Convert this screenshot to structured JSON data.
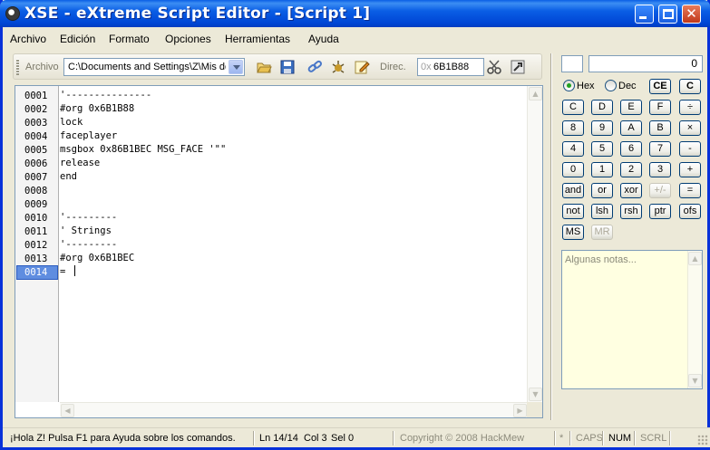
{
  "window": {
    "title": "XSE - eXtreme Script Editor - [Script 1]"
  },
  "menu": [
    "Archivo",
    "Edición",
    "Formato",
    "Opciones",
    "Herramientas",
    "Ayuda"
  ],
  "toolbar": {
    "file_label": "Archivo",
    "path_value": "C:\\Documents and Settings\\Z\\Mis documentos",
    "addr_label": "Direc.",
    "addr_prefix": "0x",
    "addr_value": "6B1B88",
    "icons": [
      "open-icon",
      "save-icon",
      "link-icon",
      "compile-icon",
      "edit-icon",
      "cut-icon",
      "tool-icon"
    ]
  },
  "editor": {
    "active_line": 14,
    "lines": [
      {
        "num": "0001",
        "text": "'---------------"
      },
      {
        "num": "0002",
        "text": "#org 0x6B1B88"
      },
      {
        "num": "0003",
        "text": "lock"
      },
      {
        "num": "0004",
        "text": "faceplayer"
      },
      {
        "num": "0005",
        "text": "msgbox 0x86B1BEC MSG_FACE '\"\""
      },
      {
        "num": "0006",
        "text": "release"
      },
      {
        "num": "0007",
        "text": "end"
      },
      {
        "num": "0008",
        "text": ""
      },
      {
        "num": "0009",
        "text": ""
      },
      {
        "num": "0010",
        "text": "'---------"
      },
      {
        "num": "0011",
        "text": "' Strings"
      },
      {
        "num": "0012",
        "text": "'---------"
      },
      {
        "num": "0013",
        "text": "#org 0x6B1BEC"
      },
      {
        "num": "0014",
        "text": "= "
      }
    ]
  },
  "calculator": {
    "display": "0",
    "mode_hex": "Hex",
    "mode_dec": "Dec",
    "mode_selected": "Hex",
    "ce": "CE",
    "c": "C",
    "rows": [
      [
        "C",
        "D",
        "E",
        "F",
        "÷"
      ],
      [
        "8",
        "9",
        "A",
        "B",
        "×"
      ],
      [
        "4",
        "5",
        "6",
        "7",
        "-"
      ],
      [
        "0",
        "1",
        "2",
        "3",
        "+"
      ],
      [
        "and",
        "or",
        "xor",
        "+/-",
        "="
      ],
      [
        "not",
        "lsh",
        "rsh",
        "ptr",
        "ofs"
      ],
      [
        "MS",
        "MR"
      ]
    ]
  },
  "notes": {
    "placeholder": "Algunas notas..."
  },
  "status": {
    "help": "¡Hola Z! Pulsa F1 para Ayuda sobre los comandos.",
    "line": "Ln 14/14",
    "col": "Col 3",
    "sel": "Sel 0",
    "copyright": "Copyright © 2008 HackMew",
    "modified": "*",
    "caps": "CAPS",
    "num": "NUM",
    "scrl": "SCRL"
  }
}
